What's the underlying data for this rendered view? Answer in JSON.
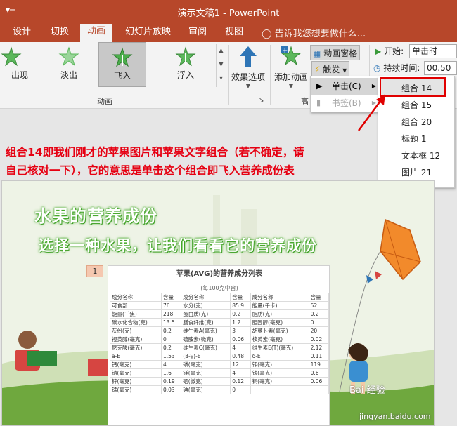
{
  "window": {
    "title": "演示文稿1 - PowerPoint",
    "qa_icon": "quick-access-icon"
  },
  "tabs": [
    "设计",
    "切换",
    "动画",
    "幻灯片放映",
    "审阅",
    "视图"
  ],
  "active_tab": "动画",
  "tell_me": "告诉我您想要做什么...",
  "ribbon": {
    "animations": [
      "出现",
      "淡出",
      "飞入",
      "浮入"
    ],
    "selected_animation": "飞入",
    "group_animation": "动画",
    "group_advanced_partial": "高",
    "effect_options": "效果选项",
    "add_animation": "添加动画",
    "animation_pane": "动画窗格",
    "trigger": "触发",
    "start_label": "开始:",
    "start_value": "单击时",
    "duration_label": "持续时间:",
    "duration_value": "00.50",
    "dialog_launcher": "↘"
  },
  "trigger_menu": {
    "items": [
      {
        "label": "单击(C)",
        "enabled": true,
        "hover": true
      },
      {
        "label": "书签(B)",
        "enabled": false,
        "hover": false
      }
    ]
  },
  "submenu": {
    "items": [
      "组合 14",
      "组合 15",
      "组合 20",
      "标题 1",
      "文本框 12",
      "图片 21",
      "· · · ·"
    ],
    "selected": "组合 14"
  },
  "annotation": {
    "line1": "组合14即我们刚才的苹果图片和苹果文字组合（若不确定，请",
    "line2": "自己核对一下），它的意思是单击这个组合即飞入营养成份表"
  },
  "slide": {
    "title": "水果的营养成份",
    "subtitle": "选择一种水果，让我们看看它的营养成份",
    "badge": "1",
    "table_title": "苹果(AVG)的营养成分列表",
    "table_subtitle": "(每100克中含)",
    "table_rows": [
      [
        "成分名称",
        "含量",
        "成分名称",
        "含量",
        "成分名称",
        "含量"
      ],
      [
        "可食部",
        "76",
        "水分(克)",
        "85.9",
        "能量(千卡)",
        "52"
      ],
      [
        "能量(千焦)",
        "218",
        "蛋白质(克)",
        "0.2",
        "脂肪(克)",
        "0.2"
      ],
      [
        "碳水化合物(克)",
        "13.5",
        "膳食纤维(克)",
        "1.2",
        "胆固醇(毫克)",
        "0"
      ],
      [
        "灰份(克)",
        "0.2",
        "维生素A(毫克)",
        "3",
        "胡萝卜素(毫克)",
        "20"
      ],
      [
        "视黄醇(毫克)",
        "0",
        "硫胺素(微克)",
        "0.06",
        "核黄素(毫克)",
        "0.02"
      ],
      [
        "尼克酸(毫克)",
        "0.2",
        "维生素C(毫克)",
        "4",
        "维生素E(T)(毫克)",
        "2.12"
      ],
      [
        "a-E",
        "1.53",
        "(β-γ)-E",
        "0.48",
        "δ-E",
        "0.11"
      ],
      [
        "钙(毫克)",
        "4",
        "磷(毫克)",
        "12",
        "钾(毫克)",
        "119"
      ],
      [
        "钠(毫克)",
        "1.6",
        "镁(毫克)",
        "4",
        "铁(毫克)",
        "0.6"
      ],
      [
        "锌(毫克)",
        "0.19",
        "硒(微克)",
        "0.12",
        "铜(毫克)",
        "0.06"
      ],
      [
        "锰(毫克)",
        "0.03",
        "碘(毫克)",
        "0",
        "",
        ""
      ]
    ],
    "watermark1": "Bai 经验",
    "watermark2": "jingyan.baidu.com"
  },
  "colors": {
    "accent": "#b7472a",
    "annotation": "#e60012",
    "highlight": "#e00000"
  }
}
